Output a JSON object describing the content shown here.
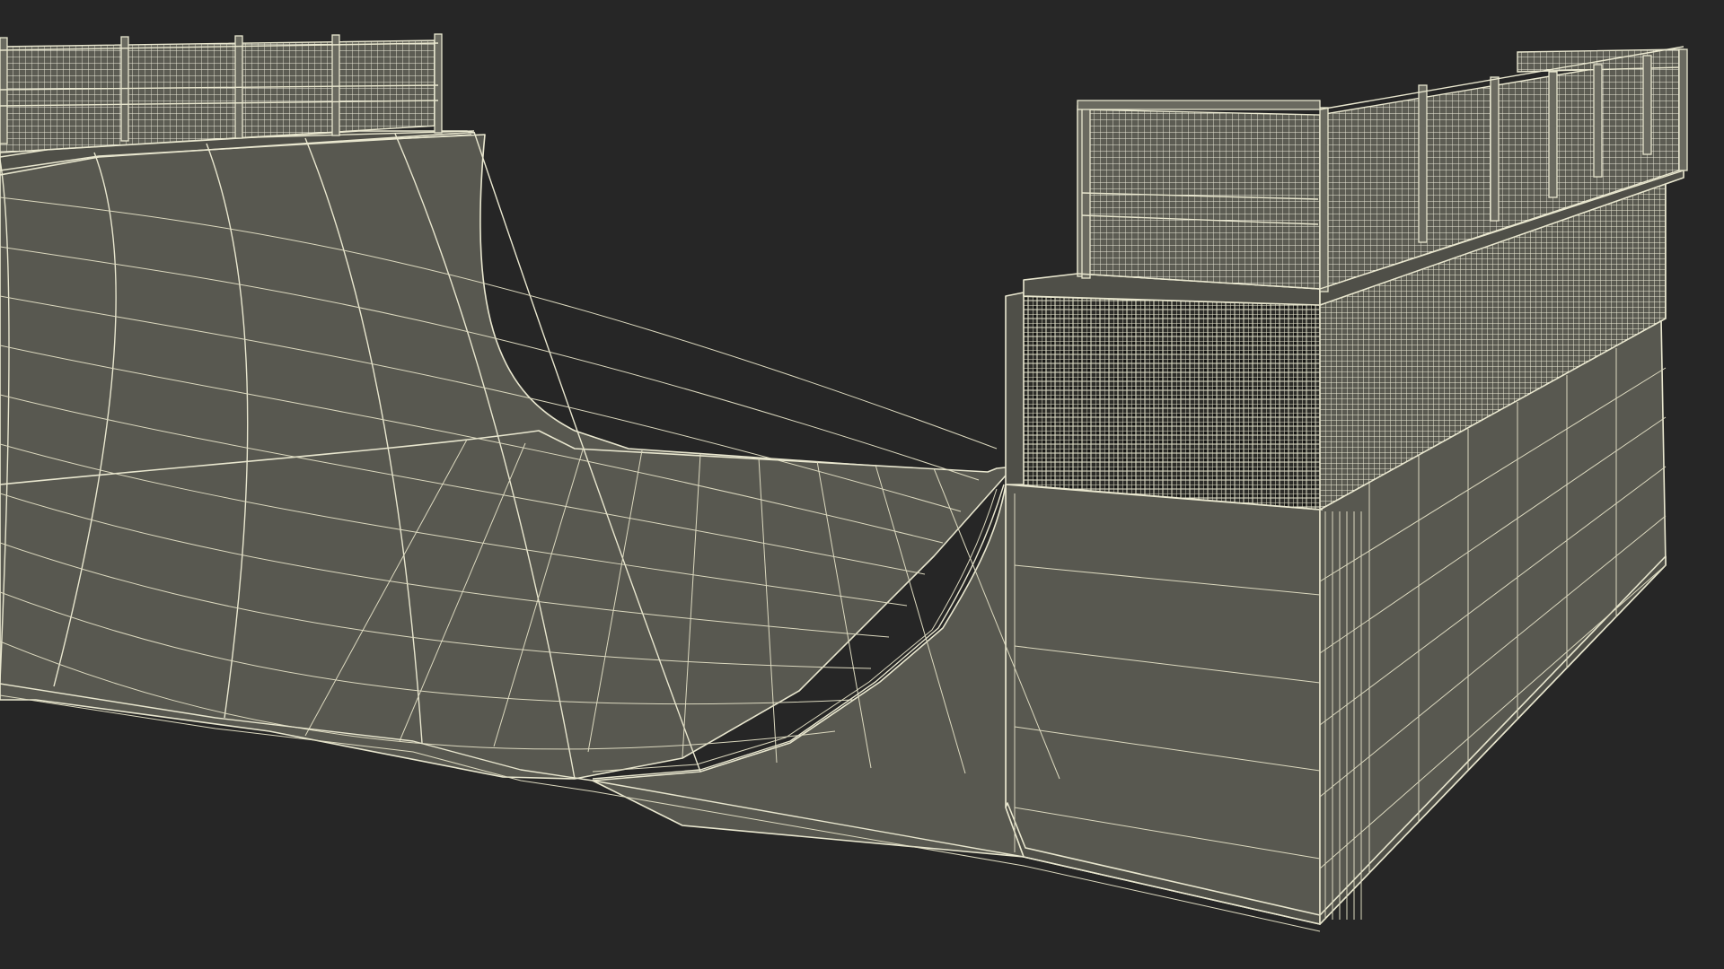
{
  "scene": {
    "title": "",
    "subject": "half-pipe-skate-ramp-wireframe",
    "background_color": "#262626",
    "surface_color": "#585850",
    "wire_color": "#e9e7cf"
  }
}
